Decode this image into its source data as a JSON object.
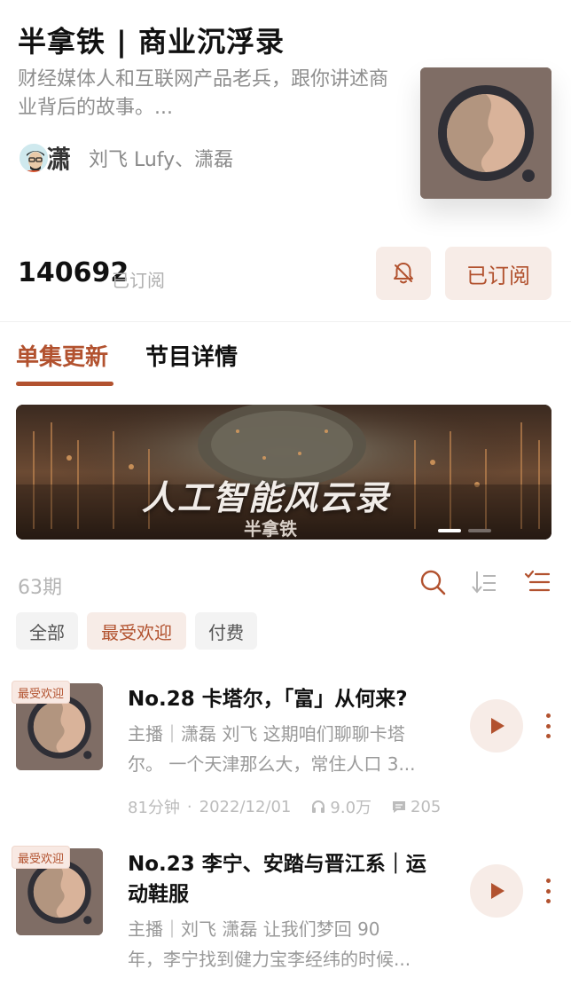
{
  "podcast": {
    "title": "半拿铁 | 商业沉浮录",
    "description": "财经媒体人和互联网产品老兵，跟你讲述商业背后的故事。...",
    "authors": "刘飞 Lufy、潇磊",
    "avatar_glyph": "潇",
    "subscriber_count": "140692",
    "subscriber_label": "已订阅",
    "subscribed_button": "已订阅"
  },
  "tabs": [
    {
      "label": "单集更新",
      "active": true
    },
    {
      "label": "节目详情",
      "active": false
    }
  ],
  "banner": {
    "title": "人工智能风云录",
    "subtitle": "半拿铁"
  },
  "episode_list": {
    "count": "63期",
    "filters": [
      "全部",
      "最受欢迎",
      "付费"
    ],
    "active_filter": "最受欢迎",
    "tools": [
      "search-icon",
      "sort-icon",
      "playlist-icon"
    ]
  },
  "episodes": [
    {
      "badge": "最受欢迎",
      "title": "No.28 卡塔尔，「富」从何来?",
      "desc_line1": "主播｜潇磊 刘飞 这期咱们聊聊卡塔",
      "desc_line2": "尔。 一个天津那么大，常住人口 3...",
      "duration": "81分钟",
      "date": "2022/12/01",
      "plays": "9.0万",
      "comments": "205"
    },
    {
      "badge": "最受欢迎",
      "title_line1": "No.23 李宁、安踏与晋江系｜运",
      "title_line2": "动鞋服",
      "desc_line1": "主播｜刘飞 潇磊 让我们梦回 90",
      "desc_line2": "年，李宁找到健力宝李经纬的时候..."
    }
  ],
  "colors": {
    "accent": "#b2522f",
    "accent_bg": "#f7ece7",
    "cover_bg": "#7f6d65",
    "cover_ring": "#2f2f36",
    "cover_inner": "#d9b39a"
  }
}
